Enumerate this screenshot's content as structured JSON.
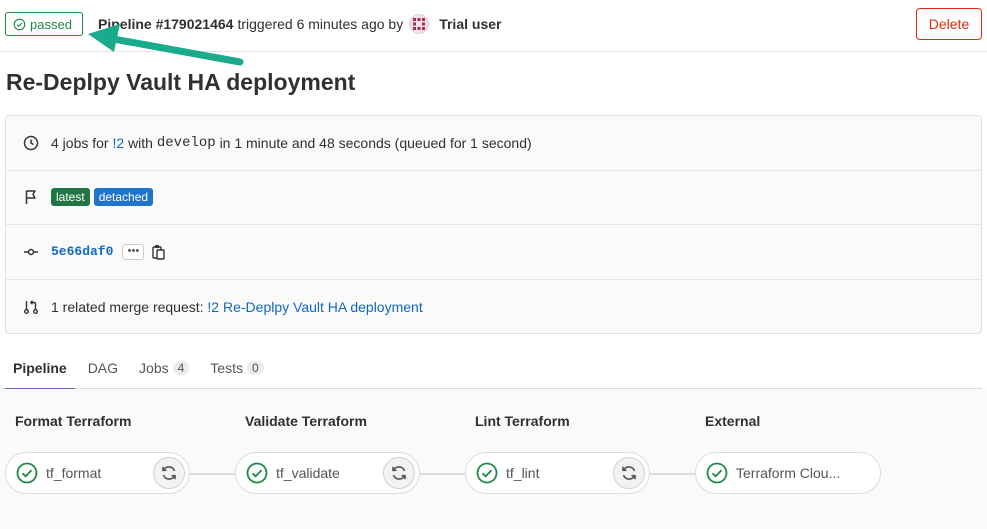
{
  "header": {
    "status": "passed",
    "pipeline_id": "Pipeline #179021464",
    "triggered": "triggered 6 minutes ago by",
    "user": "Trial user",
    "delete_label": "Delete"
  },
  "title": "Re-Deplpy Vault HA deployment",
  "info": {
    "jobs_count": "4 jobs for",
    "mr_ref": "!2",
    "with": "with",
    "branch": "develop",
    "duration": "in 1 minute and 48 seconds (queued for 1 second)",
    "badges": [
      "latest",
      "detached"
    ],
    "commit_sha": "5e66daf0",
    "ellipsis": "•••",
    "related_mr_prefix": "1 related merge request:",
    "related_mr_link": "!2 Re-Deplpy Vault HA deployment"
  },
  "tabs": [
    {
      "label": "Pipeline"
    },
    {
      "label": "DAG"
    },
    {
      "label": "Jobs",
      "count": "4"
    },
    {
      "label": "Tests",
      "count": "0"
    }
  ],
  "stages": [
    {
      "title": "Format Terraform",
      "job": "tf_format"
    },
    {
      "title": "Validate Terraform",
      "job": "tf_validate"
    },
    {
      "title": "Lint Terraform",
      "job": "tf_lint"
    },
    {
      "title": "External",
      "job": "Terraform Clou..."
    }
  ],
  "colors": {
    "success": "#1f8a45",
    "link": "#1068bf",
    "danger": "#dd2b0e",
    "annotation_arrow": "#1aab8e",
    "active_tab": "#6666c4"
  }
}
